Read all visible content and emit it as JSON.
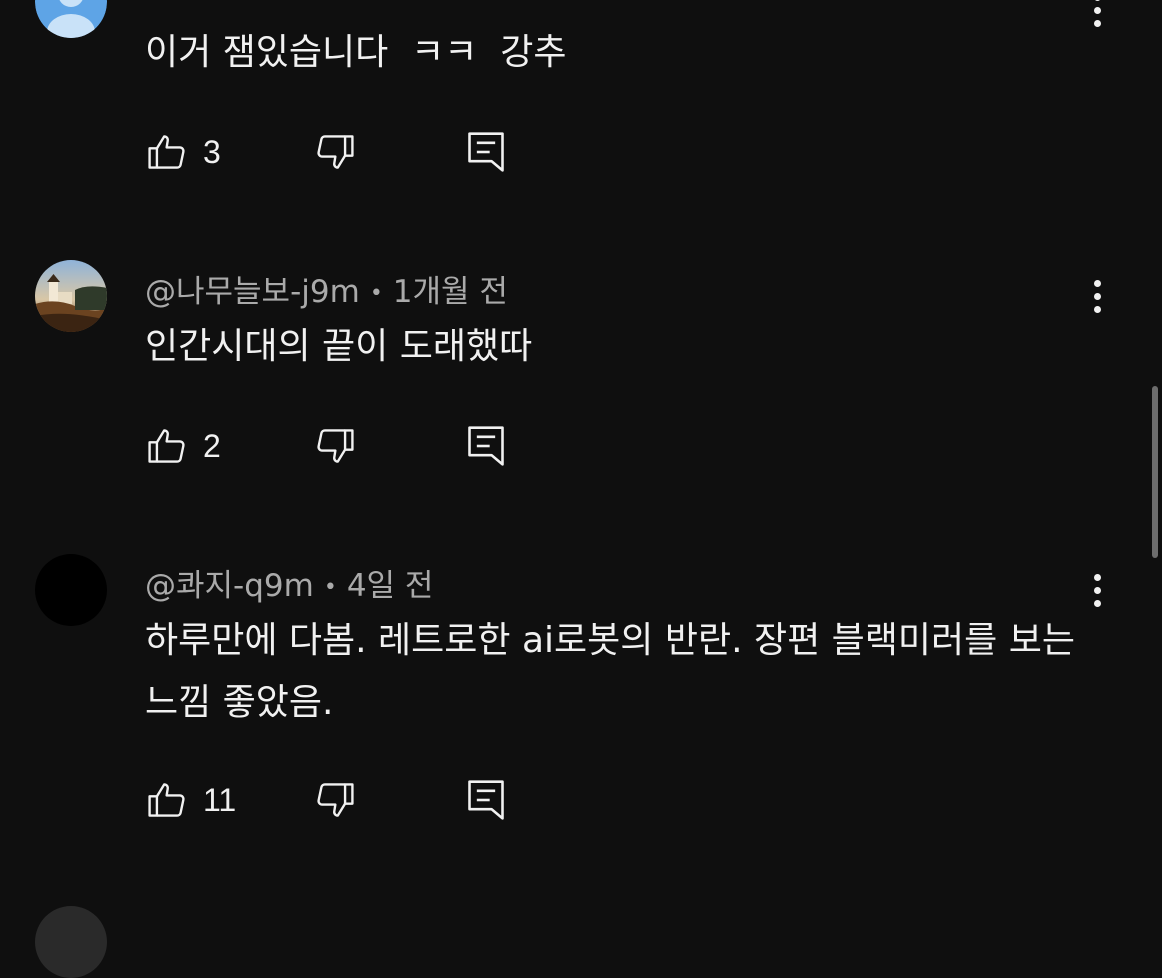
{
  "comments": [
    {
      "author": "",
      "time": "",
      "text": "이거 잼있습니다  ㅋㅋ  강추",
      "likes": "3",
      "avatar": "default-person-avatar"
    },
    {
      "author": "@나무늘보-j9m",
      "time": "1개월 전",
      "text": "인간시대의 끝이 도래했따",
      "likes": "2",
      "avatar": "lighthouse-photo-avatar"
    },
    {
      "author": "@콰지-q9m",
      "time": "4일 전",
      "text": "하루만에 다봄. 레트로한 ai로봇의 반란. 장편 블랙미러를 보는 느낌 좋았음.",
      "likes": "11",
      "avatar": "black-avatar"
    }
  ],
  "icons": {
    "like": "thumbs-up-icon",
    "dislike": "thumbs-down-icon",
    "reply": "reply-comment-icon",
    "menu": "more-vertical-icon"
  },
  "colors": {
    "background": "#0f0f0f",
    "text": "#f1f1f1",
    "meta": "#aaaaaa",
    "default_avatar": "#5ea4e6"
  }
}
